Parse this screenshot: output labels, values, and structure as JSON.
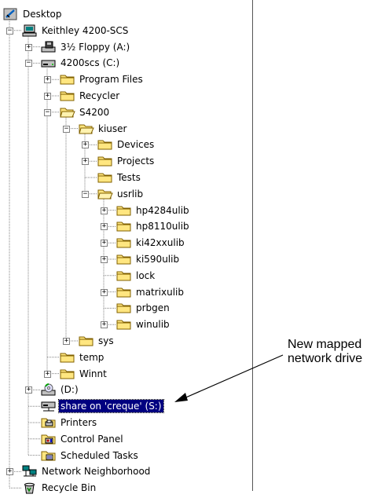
{
  "tree": {
    "items": [
      {
        "label": "Desktop",
        "icon": "desktop-icon",
        "depth": 0,
        "expander": "none",
        "name": "tree-item-desktop"
      },
      {
        "label": "Keithley 4200-SCS",
        "icon": "computer-icon",
        "depth": 1,
        "expander": "minus",
        "name": "tree-item-keithley-4200-scs"
      },
      {
        "label": "3½ Floppy (A:)",
        "icon": "floppy-drive-icon",
        "depth": 2,
        "expander": "plus",
        "name": "tree-item-floppy-a"
      },
      {
        "label": "4200scs (C:)",
        "icon": "hard-drive-icon",
        "depth": 2,
        "expander": "minus",
        "name": "tree-item-drive-c"
      },
      {
        "label": "Program Files",
        "icon": "folder-icon",
        "depth": 3,
        "expander": "plus",
        "name": "tree-item-program-files"
      },
      {
        "label": "Recycler",
        "icon": "folder-icon",
        "depth": 3,
        "expander": "plus",
        "name": "tree-item-recycler"
      },
      {
        "label": "S4200",
        "icon": "open-folder-icon",
        "depth": 3,
        "expander": "minus",
        "name": "tree-item-s4200"
      },
      {
        "label": "kiuser",
        "icon": "open-folder-icon",
        "depth": 4,
        "expander": "minus",
        "name": "tree-item-kiuser"
      },
      {
        "label": "Devices",
        "icon": "folder-icon",
        "depth": 5,
        "expander": "plus",
        "name": "tree-item-devices"
      },
      {
        "label": "Projects",
        "icon": "folder-icon",
        "depth": 5,
        "expander": "plus",
        "name": "tree-item-projects"
      },
      {
        "label": "Tests",
        "icon": "folder-icon",
        "depth": 5,
        "expander": "none",
        "name": "tree-item-tests"
      },
      {
        "label": "usrlib",
        "icon": "open-folder-icon",
        "depth": 5,
        "expander": "minus",
        "name": "tree-item-usrlib"
      },
      {
        "label": "hp4284ulib",
        "icon": "folder-icon",
        "depth": 6,
        "expander": "plus",
        "name": "tree-item-hp4284ulib"
      },
      {
        "label": "hp8110ulib",
        "icon": "folder-icon",
        "depth": 6,
        "expander": "plus",
        "name": "tree-item-hp8110ulib"
      },
      {
        "label": "ki42xxulib",
        "icon": "folder-icon",
        "depth": 6,
        "expander": "plus",
        "name": "tree-item-ki42xxulib"
      },
      {
        "label": "ki590ulib",
        "icon": "folder-icon",
        "depth": 6,
        "expander": "plus",
        "name": "tree-item-ki590ulib"
      },
      {
        "label": "lock",
        "icon": "folder-icon",
        "depth": 6,
        "expander": "none",
        "name": "tree-item-lock"
      },
      {
        "label": "matrixulib",
        "icon": "folder-icon",
        "depth": 6,
        "expander": "plus",
        "name": "tree-item-matrixulib"
      },
      {
        "label": "prbgen",
        "icon": "folder-icon",
        "depth": 6,
        "expander": "none",
        "name": "tree-item-prbgen"
      },
      {
        "label": "winulib",
        "icon": "folder-icon",
        "depth": 6,
        "expander": "plus",
        "name": "tree-item-winulib"
      },
      {
        "label": "sys",
        "icon": "folder-icon",
        "depth": 4,
        "expander": "plus",
        "name": "tree-item-sys"
      },
      {
        "label": "temp",
        "icon": "folder-icon",
        "depth": 3,
        "expander": "none",
        "name": "tree-item-temp"
      },
      {
        "label": "Winnt",
        "icon": "folder-icon",
        "depth": 3,
        "expander": "plus",
        "name": "tree-item-winnt"
      },
      {
        "label": "(D:)",
        "icon": "cd-drive-icon",
        "depth": 2,
        "expander": "plus",
        "name": "tree-item-drive-d"
      },
      {
        "label": "share on 'creque' (S:)",
        "icon": "network-drive-icon",
        "depth": 2,
        "expander": "none",
        "name": "tree-item-share-creque",
        "selected": true
      },
      {
        "label": "Printers",
        "icon": "printers-folder-icon",
        "depth": 2,
        "expander": "none",
        "name": "tree-item-printers"
      },
      {
        "label": "Control Panel",
        "icon": "control-panel-icon",
        "depth": 2,
        "expander": "none",
        "name": "tree-item-control-panel"
      },
      {
        "label": "Scheduled Tasks",
        "icon": "scheduled-tasks-icon",
        "depth": 2,
        "expander": "none",
        "name": "tree-item-scheduled-tasks"
      },
      {
        "label": "Network Neighborhood",
        "icon": "network-neighborhood-icon",
        "depth": 1,
        "expander": "plus",
        "name": "tree-item-network-neighborhood"
      },
      {
        "label": "Recycle Bin",
        "icon": "recycle-bin-icon",
        "depth": 1,
        "expander": "none",
        "name": "tree-item-recycle-bin"
      }
    ]
  },
  "callout": {
    "line1": "New mapped",
    "line2": "network drive"
  },
  "colors": {
    "selection": "#000080",
    "folder": "#ffe680",
    "folder_outline": "#806000"
  }
}
